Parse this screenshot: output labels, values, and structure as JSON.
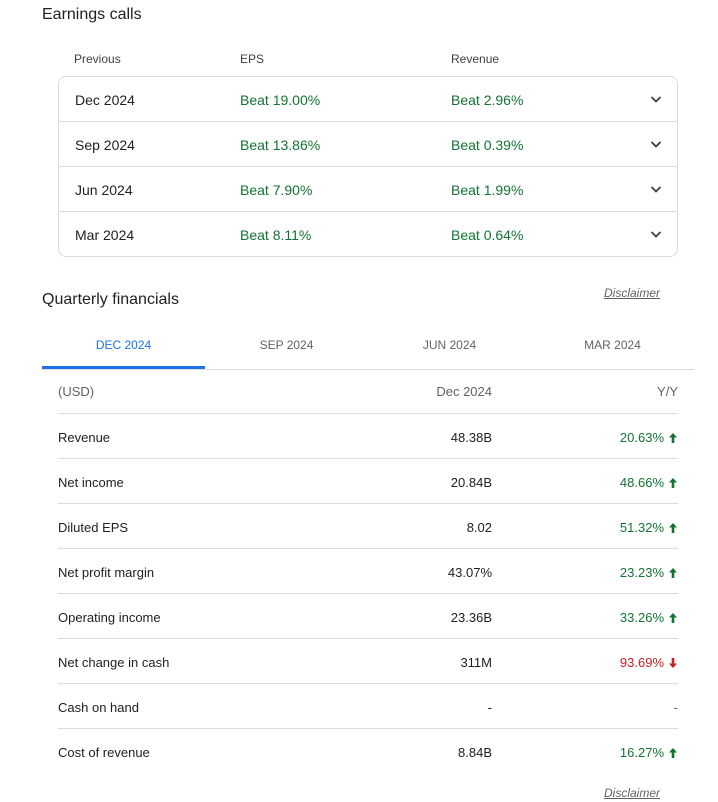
{
  "earnings_calls": {
    "title": "Earnings calls",
    "columns": {
      "previous": "Previous",
      "eps": "EPS",
      "revenue": "Revenue"
    },
    "rows": [
      {
        "quarter": "Dec 2024",
        "eps": "Beat 19.00%",
        "revenue": "Beat 2.96%"
      },
      {
        "quarter": "Sep 2024",
        "eps": "Beat 13.86%",
        "revenue": "Beat 0.39%"
      },
      {
        "quarter": "Jun 2024",
        "eps": "Beat 7.90%",
        "revenue": "Beat 1.99%"
      },
      {
        "quarter": "Mar 2024",
        "eps": "Beat 8.11%",
        "revenue": "Beat 0.64%"
      }
    ]
  },
  "quarterly_financials": {
    "title": "Quarterly financials",
    "disclaimer": "Disclaimer",
    "tabs": [
      "DEC 2024",
      "SEP 2024",
      "JUN 2024",
      "MAR 2024"
    ],
    "active_tab": "DEC 2024",
    "header": {
      "currency": "(USD)",
      "period": "Dec 2024",
      "change": "Y/Y"
    },
    "rows": [
      {
        "label": "Revenue",
        "value": "48.38B",
        "change": "20.63%",
        "trend": "up"
      },
      {
        "label": "Net income",
        "value": "20.84B",
        "change": "48.66%",
        "trend": "up"
      },
      {
        "label": "Diluted EPS",
        "value": "8.02",
        "change": "51.32%",
        "trend": "up"
      },
      {
        "label": "Net profit margin",
        "value": "43.07%",
        "change": "23.23%",
        "trend": "up"
      },
      {
        "label": "Operating income",
        "value": "23.36B",
        "change": "33.26%",
        "trend": "up"
      },
      {
        "label": "Net change in cash",
        "value": "311M",
        "change": "93.69%",
        "trend": "down"
      },
      {
        "label": "Cash on hand",
        "value": "-",
        "change": "-",
        "trend": "none"
      },
      {
        "label": "Cost of revenue",
        "value": "8.84B",
        "change": "16.27%",
        "trend": "up"
      }
    ]
  },
  "colors": {
    "positive": "#137333",
    "negative": "#c5221f",
    "accent": "#1a73e8"
  }
}
